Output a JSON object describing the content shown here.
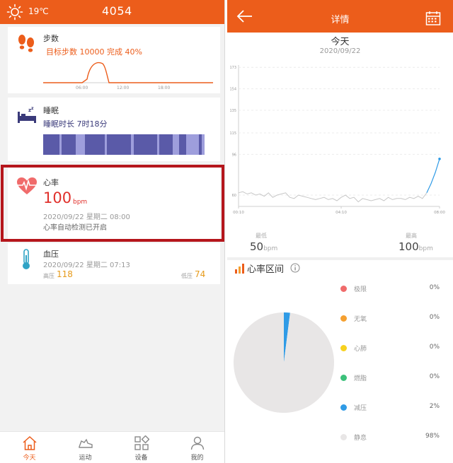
{
  "left": {
    "header": {
      "temperature": "19℃",
      "step_count": "4054"
    },
    "steps_card": {
      "title": "步数",
      "summary": "目标步数 10000 完成 40%",
      "ticks": [
        "06:00",
        "12:00",
        "18:00"
      ]
    },
    "sleep_card": {
      "title": "睡眠",
      "summary": "睡眠时长 7时18分"
    },
    "heart_card": {
      "title": "心率",
      "value": "100",
      "unit": "bpm",
      "datetime": "2020/09/22 星期二 08:00",
      "status": "心率自动检测已开启"
    },
    "bp_card": {
      "title": "血压",
      "datetime": "2020/09/22 星期二 07:13",
      "high_label": "高压",
      "high_value": "118",
      "low_label": "低压",
      "low_value": "74"
    },
    "nav": [
      {
        "label": "今天",
        "active": true
      },
      {
        "label": "运动"
      },
      {
        "label": "设备"
      },
      {
        "label": "我的"
      }
    ],
    "colors": {
      "brand": "#ec5d1b",
      "sleep_deep": "#5a5aa8",
      "sleep_light": "#9e9edc"
    }
  },
  "right": {
    "header": {
      "title": "详情"
    },
    "day_label": "今天",
    "date": "2020/09/22",
    "min_label": "最低",
    "min_value": "50",
    "max_label": "最高",
    "max_value": "100",
    "unit": "bpm",
    "zones_title": "心率区间",
    "zones": [
      {
        "name": "极限",
        "percent": "0%",
        "color": "#f06b6b"
      },
      {
        "name": "无氧",
        "percent": "0%",
        "color": "#f5a030"
      },
      {
        "name": "心肺",
        "percent": "0%",
        "color": "#f7d11e"
      },
      {
        "name": "燃脂",
        "percent": "0%",
        "color": "#3cc17a"
      },
      {
        "name": "减压",
        "percent": "2%",
        "color": "#2f9be6"
      },
      {
        "name": "静息",
        "percent": "98%",
        "color": "#e8e6e6"
      }
    ]
  },
  "chart_data": {
    "type": "line",
    "yticks": [
      "173",
      "154",
      "135",
      "115",
      "96",
      "60"
    ],
    "ylim": [
      50,
      175
    ],
    "x_tick_labels": [
      "00:10",
      "04:10",
      "08:00"
    ],
    "xlim": [
      10,
      480
    ],
    "grid": true,
    "series": [
      {
        "x": [
          10,
          20,
          30,
          40,
          50,
          60,
          70,
          80,
          90,
          100,
          110,
          120,
          130,
          140,
          150,
          160,
          170,
          180,
          190,
          200,
          210,
          220,
          230,
          240,
          250,
          260,
          270,
          280,
          290,
          300,
          310,
          320,
          330,
          340,
          350,
          360,
          370,
          380,
          390,
          400,
          410,
          420,
          430,
          440,
          450,
          460,
          470,
          480
        ],
        "y": [
          62,
          63,
          61,
          62,
          60,
          61,
          59,
          62,
          58,
          60,
          61,
          62,
          58,
          57,
          60,
          59,
          58,
          57,
          56,
          57,
          58,
          56,
          57,
          55,
          58,
          60,
          57,
          58,
          54,
          57,
          56,
          55,
          56,
          57,
          55,
          58,
          56,
          57,
          57,
          56,
          58,
          57,
          59,
          57,
          62,
          70,
          80,
          92
        ]
      }
    ]
  },
  "pie_data": {
    "type": "pie",
    "labels": [
      "极限",
      "无氧",
      "心肺",
      "燃脂",
      "减压",
      "静息"
    ],
    "values": [
      0,
      0,
      0,
      0,
      2,
      98
    ]
  }
}
